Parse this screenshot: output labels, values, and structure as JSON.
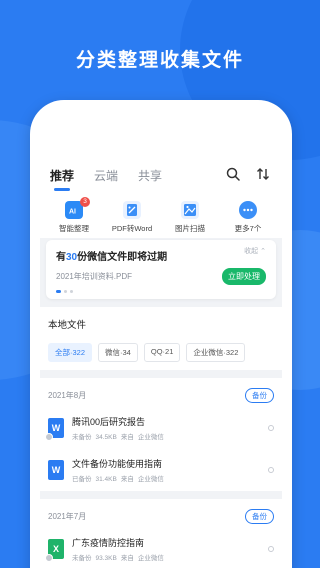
{
  "headline": "分类整理收集文件",
  "tabs": [
    {
      "label": "推荐"
    },
    {
      "label": "云端"
    },
    {
      "label": "共享"
    }
  ],
  "quick_actions": [
    {
      "label": "智能整理",
      "badge": "3",
      "icon": "ai-folder-icon",
      "color": "#2b8af6"
    },
    {
      "label": "PDF转Word",
      "icon": "pdf-to-word-icon",
      "color": "#3b8ff7"
    },
    {
      "label": "图片扫描",
      "icon": "image-scan-icon",
      "color": "#3b8ff7"
    },
    {
      "label": "更多7个",
      "icon": "more-icon",
      "color": "#3b8ff7"
    }
  ],
  "notice": {
    "title_prefix": "有",
    "count": "30",
    "title_suffix": "份微信文件即将过期",
    "subtitle": "2021年培训资料.PDF",
    "collapse": "收起",
    "action": "立即处理"
  },
  "local": {
    "title": "本地文件",
    "filters": [
      {
        "label": "全部·322",
        "active": true
      },
      {
        "label": "微信·34",
        "active": false
      },
      {
        "label": "QQ·21",
        "active": false
      },
      {
        "label": "企业微信·322",
        "active": false
      }
    ]
  },
  "groups": [
    {
      "date": "2021年8月",
      "tag": "备份",
      "files": [
        {
          "name": "腾讯00后研究报告",
          "type": "W",
          "color": "#2b7cf2",
          "status": "未备份",
          "size": "34.5KB",
          "source_prefix": "来自",
          "source": "企业微信"
        },
        {
          "name": "文件备份功能使用指南",
          "type": "W",
          "color": "#2b7cf2",
          "status": "已备份",
          "size": "31.4KB",
          "source_prefix": "来自",
          "source": "企业微信"
        }
      ]
    },
    {
      "date": "2021年7月",
      "tag": "备份",
      "files": [
        {
          "name": "广东疫情防控指南",
          "type": "X",
          "color": "#1fb36a",
          "status": "未备份",
          "size": "93.3KB",
          "source_prefix": "来自",
          "source": "企业微信"
        }
      ]
    }
  ]
}
